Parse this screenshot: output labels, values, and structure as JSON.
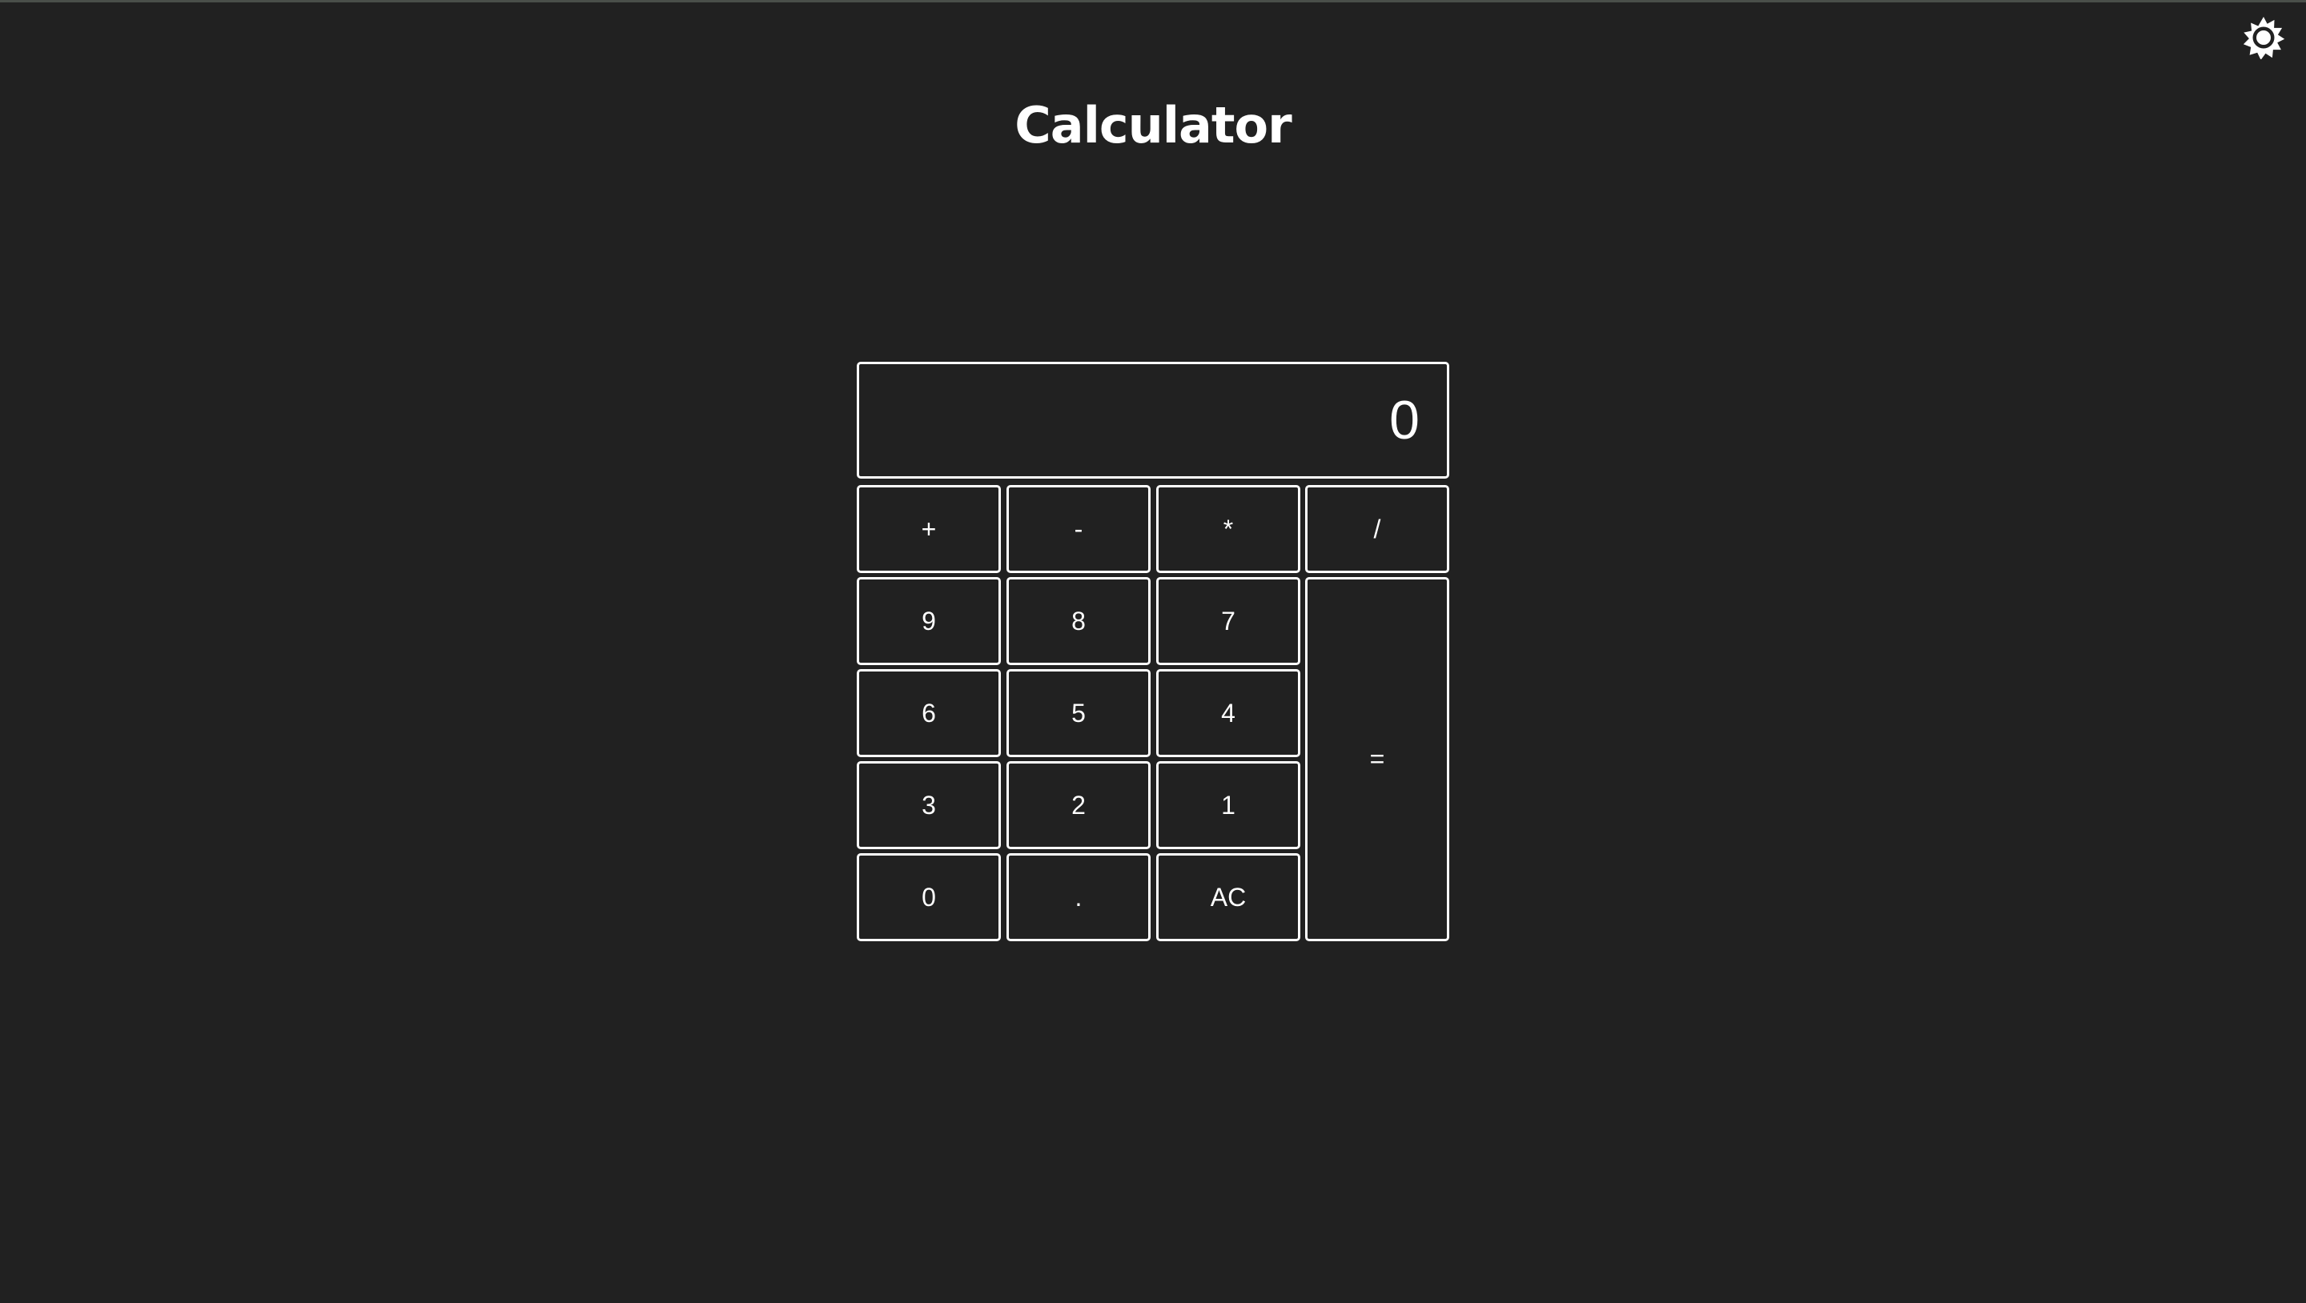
{
  "header": {
    "title": "Calculator",
    "theme_toggle_icon": "sun-icon"
  },
  "display": {
    "value": "0"
  },
  "keys": {
    "plus": "+",
    "minus": "-",
    "multiply": "*",
    "divide": "/",
    "nine": "9",
    "eight": "8",
    "seven": "7",
    "six": "6",
    "five": "5",
    "four": "4",
    "three": "3",
    "two": "2",
    "one": "1",
    "zero": "0",
    "decimal": ".",
    "clear": "AC",
    "equals": "="
  },
  "colors": {
    "background": "#212121",
    "foreground": "#ffffff",
    "border": "#ffffff"
  }
}
